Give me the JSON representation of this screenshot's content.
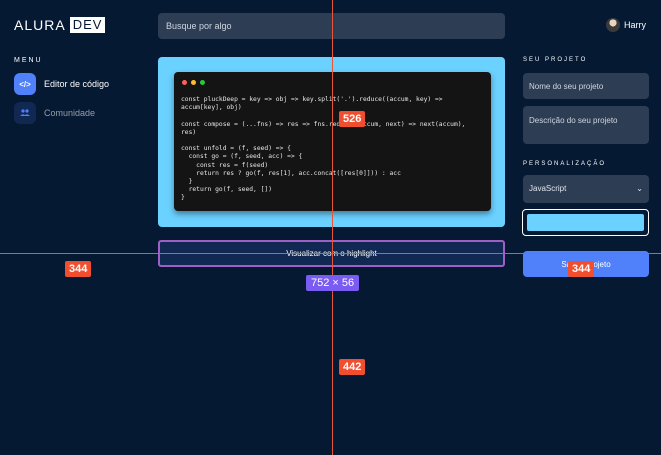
{
  "header": {
    "logo_text": "ALURA",
    "logo_box": "DEV",
    "search_placeholder": "Busque por algo",
    "user_name": "Harry"
  },
  "sidebar": {
    "title": "MENU",
    "items": [
      {
        "label": "Editor de código",
        "icon": "code-icon",
        "glyph": "</>"
      },
      {
        "label": "Comunidade",
        "icon": "people-icon",
        "glyph": "ꜛꜛ"
      }
    ]
  },
  "editor": {
    "window_dots": [
      "#ff5f56",
      "#ffbd2e",
      "#27c93f"
    ],
    "code": "const pluckDeep = key => obj => key.split('.').reduce((accum, key) =>\naccum[key], obj)\n\nconst compose = (...fns) => res => fns.reduce((accum, next) => next(accum),\nres)\n\nconst unfold = (f, seed) => {\n  const go = (f, seed, acc) => {\n    const res = f(seed)\n    return res ? go(f, res[1], acc.concat([res[0]])) : acc\n  }\n  return go(f, seed, [])\n}",
    "frame_color": "#6bd1ff",
    "highlight_label": "Visualizar com o highlight"
  },
  "project": {
    "title": "SEU PROJETO",
    "name_placeholder": "Nome do seu projeto",
    "description_placeholder": "Descrição do seu projeto",
    "personalization_title": "PERSONALIZAÇÃO",
    "language_selected": "JavaScript",
    "color_value": "#6bd1ff",
    "save_label": "Salvar projeto"
  },
  "overlay": {
    "guide_color": "#e8563a",
    "tags": {
      "top": "526",
      "left": "344",
      "right": "344",
      "bottom": "442"
    },
    "dimension": "752 × 56"
  }
}
